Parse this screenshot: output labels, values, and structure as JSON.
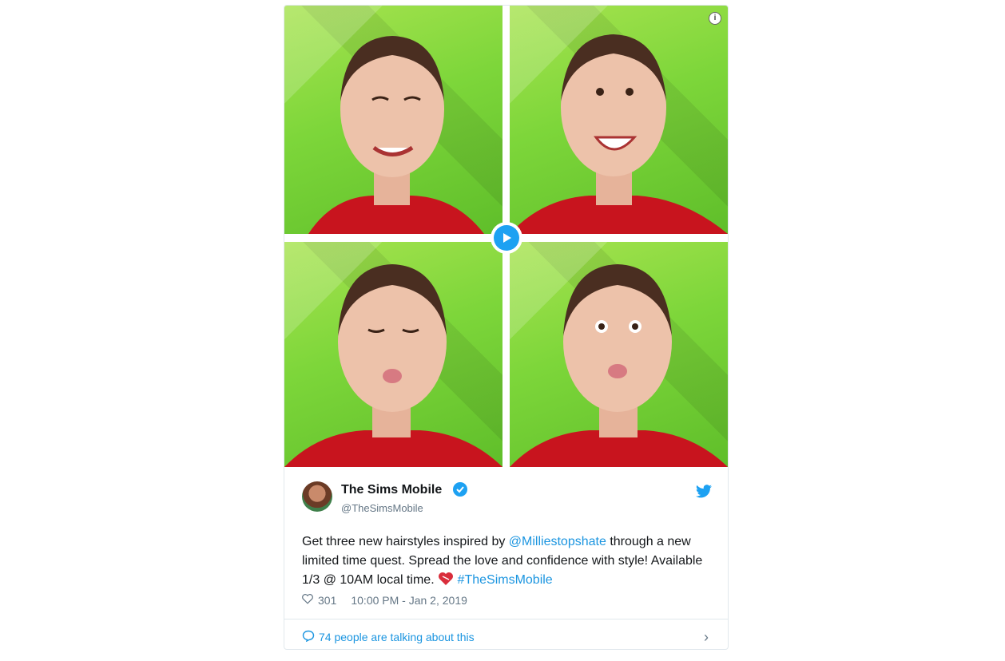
{
  "media": {
    "info_icon": "info-icon",
    "play_icon": "play-icon",
    "tiles": [
      {
        "expression": "smile"
      },
      {
        "expression": "laugh"
      },
      {
        "expression": "kiss-eyes-closed"
      },
      {
        "expression": "kiss-eyes-open"
      }
    ]
  },
  "tweet": {
    "display_name": "The Sims Mobile",
    "handle": "@TheSimsMobile",
    "text_part1": "Get three new hairstyles inspired by ",
    "mention": "@Milliestopshate",
    "text_part2": " through a new limited time quest. Spread the love and confidence with style! Available 1/3 @ 10AM local time. ",
    "hashtag": "#TheSimsMobile",
    "likes": "301",
    "timestamp": "10:00 PM - Jan 2, 2019",
    "talking": "74 people are talking about this"
  },
  "colors": {
    "accent": "#1da1f2",
    "link": "#1b95e0",
    "background_green": "#7dd63a",
    "text": "#14171a",
    "muted": "#657786"
  }
}
